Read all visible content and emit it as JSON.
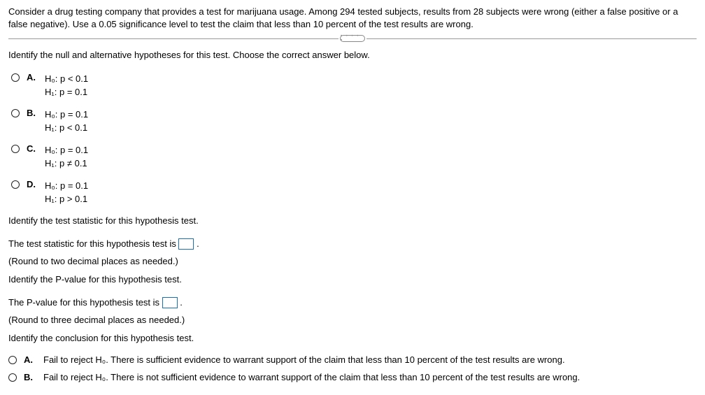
{
  "problem": {
    "text": "Consider a drug testing company that provides a test for marijuana usage. Among 294 tested subjects, results from 28 subjects were wrong (either a false positive or a false negative). Use a 0.05 significance level to test the claim that less than 10 percent of the test results are wrong."
  },
  "q1": {
    "prompt": "Identify the null and alternative hypotheses for this test. Choose the correct answer below.",
    "choices": {
      "a": {
        "letter": "A.",
        "line1": "H₀: p < 0.1",
        "line2": "H₁: p = 0.1"
      },
      "b": {
        "letter": "B.",
        "line1": "H₀: p = 0.1",
        "line2": "H₁: p < 0.1"
      },
      "c": {
        "letter": "C.",
        "line1": "H₀: p = 0.1",
        "line2": "H₁: p ≠ 0.1"
      },
      "d": {
        "letter": "D.",
        "line1": "H₀: p = 0.1",
        "line2": "H₁: p > 0.1"
      }
    }
  },
  "q2": {
    "prompt": "Identify the test statistic for this hypothesis test.",
    "answer_prefix": "The test statistic for this hypothesis test is ",
    "answer_suffix": ".",
    "hint": "(Round to two decimal places as needed.)"
  },
  "q3": {
    "prompt": "Identify the P-value for this hypothesis test.",
    "answer_prefix": "The P-value for this hypothesis test is ",
    "answer_suffix": ".",
    "hint": "(Round to three decimal places as needed.)"
  },
  "q4": {
    "prompt": "Identify the conclusion for this hypothesis test.",
    "choices": {
      "a": {
        "letter": "A.",
        "text": "Fail to reject H₀. There is sufficient evidence to warrant support of the claim that less than 10 percent of the test results are wrong."
      },
      "b": {
        "letter": "B.",
        "text": "Fail to reject H₀. There is not sufficient evidence to warrant support of the claim that less than 10 percent of the test results are wrong."
      }
    }
  }
}
